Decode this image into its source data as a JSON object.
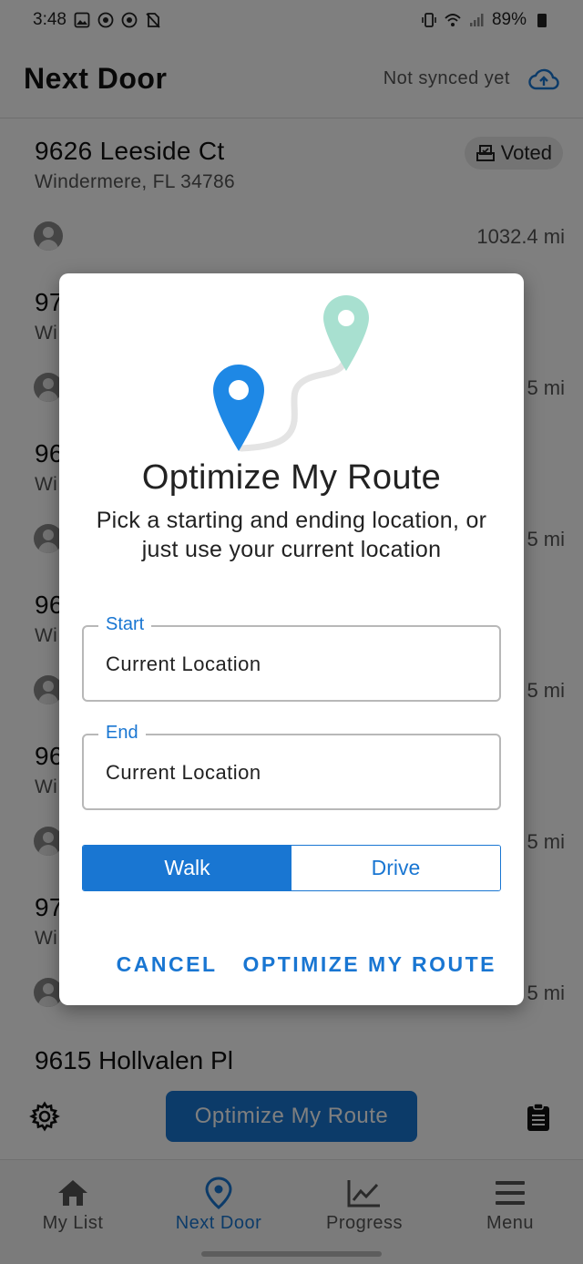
{
  "status_bar": {
    "time": "3:48",
    "battery": "89%"
  },
  "header": {
    "title": "Next Door",
    "sync_status": "Not synced yet",
    "sync_icon": "cloud-upload-icon"
  },
  "list": {
    "items": [
      {
        "address": "9626 Leeside Ct",
        "city": "Windermere, FL 34786",
        "distance": "1032.4 mi",
        "badge": "Voted"
      },
      {
        "address": "97",
        "city": "Wi",
        "distance": "5 mi"
      },
      {
        "address": "96",
        "city": "Wi",
        "distance": "5 mi"
      },
      {
        "address": "96",
        "city": "Wi",
        "distance": "5 mi"
      },
      {
        "address": "96",
        "city": "Wi",
        "distance": "5 mi"
      },
      {
        "address": "97",
        "city": "Wi",
        "distance": "5 mi"
      }
    ],
    "last_address": "9615 Hollvalen Pl"
  },
  "action_bar": {
    "optimize_label": "Optimize My Route"
  },
  "bottom_nav": {
    "items": [
      {
        "label": "My List",
        "icon": "home-icon"
      },
      {
        "label": "Next Door",
        "icon": "location-pin-icon"
      },
      {
        "label": "Progress",
        "icon": "trending-chart-icon"
      },
      {
        "label": "Menu",
        "icon": "hamburger-menu-icon"
      }
    ]
  },
  "dialog": {
    "title": "Optimize My Route",
    "subtitle": "Pick a starting and ending location, or just use your current location",
    "start": {
      "label": "Start",
      "value": "Current Location"
    },
    "end": {
      "label": "End",
      "value": "Current Location"
    },
    "mode": {
      "options": [
        "Walk",
        "Drive"
      ],
      "selected": "Walk"
    },
    "cancel_label": "CANCEL",
    "confirm_label": "OPTIMIZE MY ROUTE"
  },
  "colors": {
    "accent": "#1976d2",
    "pin_start": "#1e88e5",
    "pin_end": "#a8e0d0"
  }
}
